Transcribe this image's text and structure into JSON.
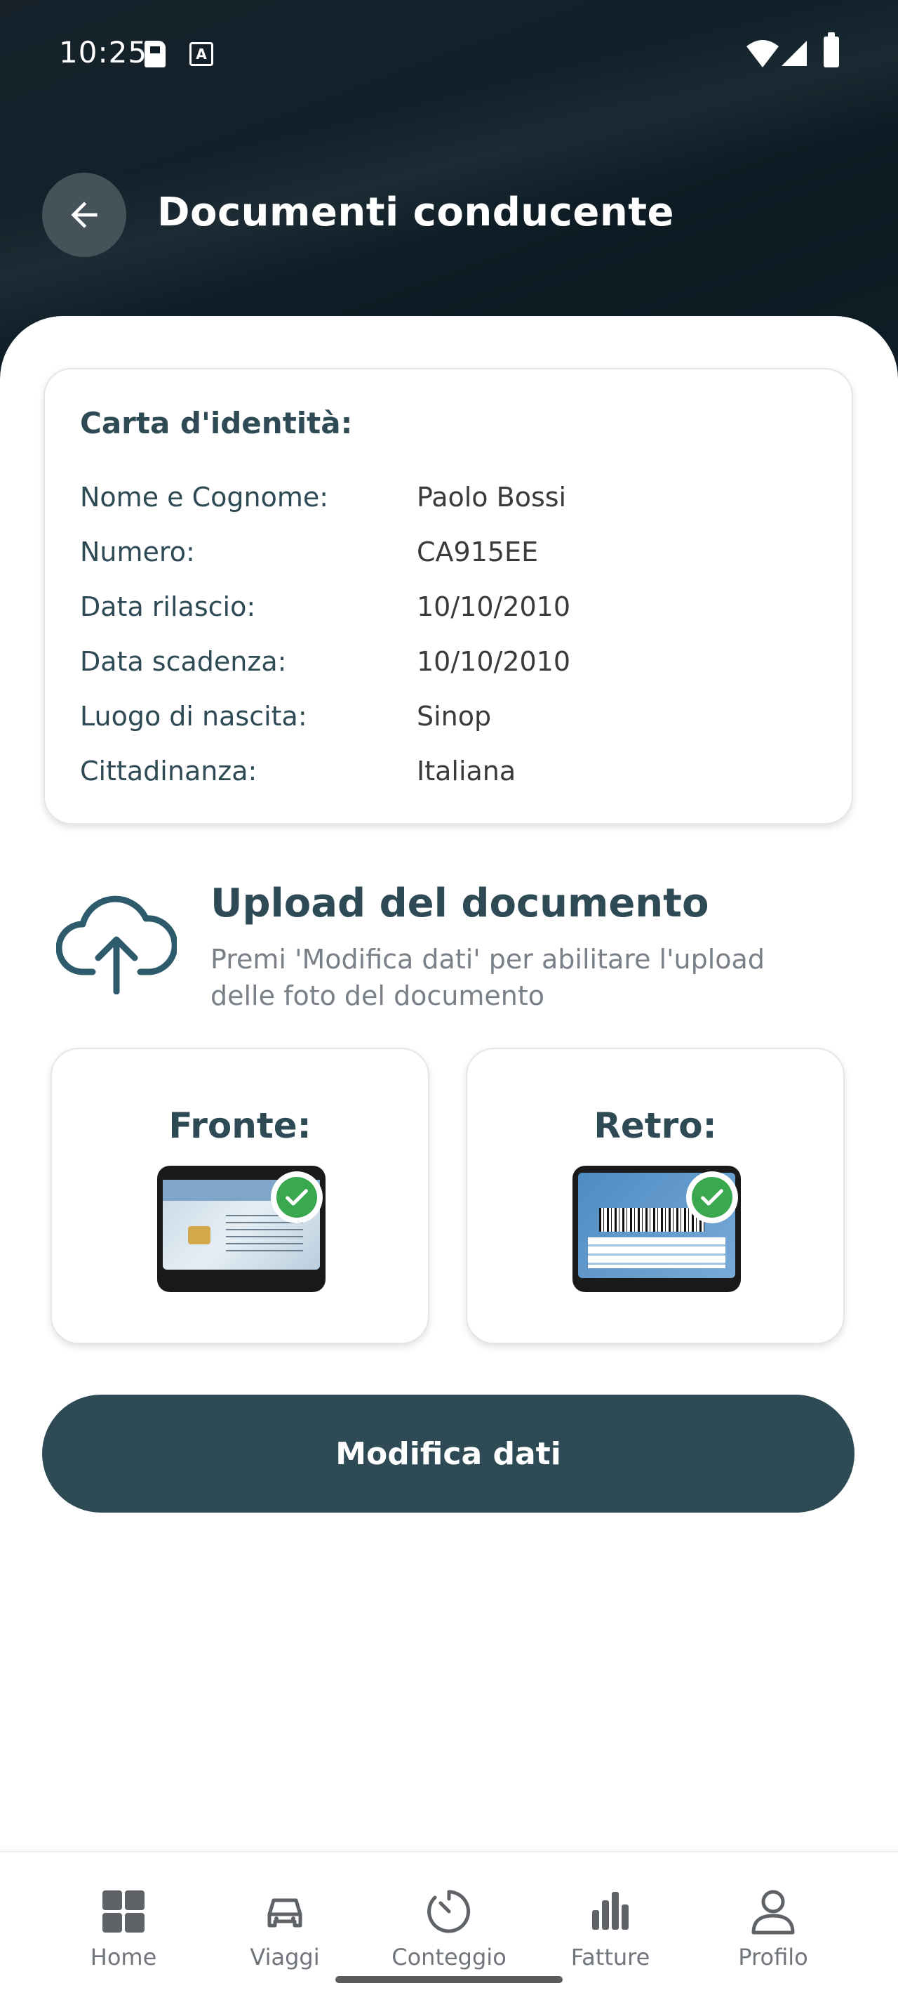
{
  "status_bar": {
    "time": "10:25"
  },
  "header": {
    "title": "Documenti conducente"
  },
  "id_card": {
    "title": "Carta d'identità:",
    "rows": [
      {
        "label": "Nome e Cognome:",
        "value": "Paolo Bossi"
      },
      {
        "label": "Numero:",
        "value": "CA915EE"
      },
      {
        "label": "Data rilascio:",
        "value": "10/10/2010"
      },
      {
        "label": "Data scadenza:",
        "value": "10/10/2010"
      },
      {
        "label": "Luogo di nascita:",
        "value": "Sinop"
      },
      {
        "label": "Cittadinanza:",
        "value": "Italiana"
      }
    ]
  },
  "upload": {
    "title": "Upload del documento",
    "description": "Premi 'Modifica dati' per abilitare l'upload delle foto del documento"
  },
  "documents": {
    "front_label": "Fronte:",
    "back_label": "Retro:"
  },
  "actions": {
    "edit_label": "Modifica dati"
  },
  "bottom_nav": {
    "items": [
      {
        "label": "Home",
        "icon": "home-grid-icon"
      },
      {
        "label": "Viaggi",
        "icon": "car-icon"
      },
      {
        "label": "Conteggio",
        "icon": "timer-icon"
      },
      {
        "label": "Fatture",
        "icon": "bar-chart-icon"
      },
      {
        "label": "Profilo",
        "icon": "person-icon"
      }
    ]
  },
  "colors": {
    "primary": "#2d4a55",
    "header_bg": "#0f1d26",
    "check": "#3aa84e"
  }
}
